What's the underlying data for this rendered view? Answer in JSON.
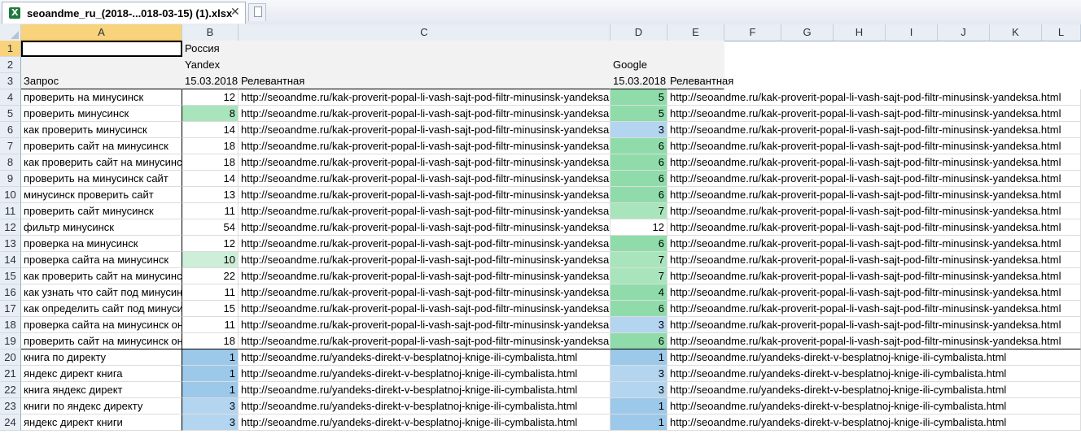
{
  "tab": {
    "title": "seoandme_ru_(2018-...018-03-15) (1).xlsx",
    "close": "✕"
  },
  "columns": [
    "A",
    "B",
    "C",
    "D",
    "E",
    "F",
    "G",
    "H",
    "I",
    "J",
    "K",
    "L"
  ],
  "header": {
    "region": "Россия",
    "yandex": "Yandex",
    "google": "Google",
    "query": "Запрос",
    "date": "15.03.2018",
    "relevant": "Релевантная"
  },
  "colors": {
    "green_dark": "#8fdcaa",
    "green_mid": "#a9e5bc",
    "green_light": "#cdeed8",
    "blue_dark": "#9cc8ea",
    "blue_mid": "#b3d5f0",
    "blue_light": "#c7e0f4"
  },
  "rows": [
    {
      "n": "4",
      "query": "проверить на минусинск",
      "y": "12",
      "yurl": "http://seoandme.ru/kak-proverit-popal-li-vash-sajt-pod-filtr-minusinsk-yandeksa.html",
      "g": "5",
      "gurl": "http://seoandme.ru/kak-proverit-popal-li-vash-sajt-pod-filtr-minusinsk-yandeksa.html",
      "yc": "",
      "gc": "green_dark"
    },
    {
      "n": "5",
      "query": "проверить минусинск",
      "y": "8",
      "yurl": "http://seoandme.ru/kak-proverit-popal-li-vash-sajt-pod-filtr-minusinsk-yandeksa.html",
      "g": "5",
      "gurl": "http://seoandme.ru/kak-proverit-popal-li-vash-sajt-pod-filtr-minusinsk-yandeksa.html",
      "yc": "green_mid",
      "gc": "green_dark"
    },
    {
      "n": "6",
      "query": "как проверить минусинск",
      "y": "14",
      "yurl": "http://seoandme.ru/kak-proverit-popal-li-vash-sajt-pod-filtr-minusinsk-yandeksa.html",
      "g": "3",
      "gurl": "http://seoandme.ru/kak-proverit-popal-li-vash-sajt-pod-filtr-minusinsk-yandeksa.html",
      "yc": "",
      "gc": "blue_mid"
    },
    {
      "n": "7",
      "query": "проверить сайт на минусинск",
      "y": "18",
      "yurl": "http://seoandme.ru/kak-proverit-popal-li-vash-sajt-pod-filtr-minusinsk-yandeksa.html",
      "g": "6",
      "gurl": "http://seoandme.ru/kak-proverit-popal-li-vash-sajt-pod-filtr-minusinsk-yandeksa.html",
      "yc": "",
      "gc": "green_dark"
    },
    {
      "n": "8",
      "query": "как проверить сайт на минусинск",
      "y": "18",
      "yurl": "http://seoandme.ru/kak-proverit-popal-li-vash-sajt-pod-filtr-minusinsk-yandeksa.html",
      "g": "6",
      "gurl": "http://seoandme.ru/kak-proverit-popal-li-vash-sajt-pod-filtr-minusinsk-yandeksa.html",
      "yc": "",
      "gc": "green_dark"
    },
    {
      "n": "9",
      "query": "проверить на минусинск сайт",
      "y": "14",
      "yurl": "http://seoandme.ru/kak-proverit-popal-li-vash-sajt-pod-filtr-minusinsk-yandeksa.html",
      "g": "6",
      "gurl": "http://seoandme.ru/kak-proverit-popal-li-vash-sajt-pod-filtr-minusinsk-yandeksa.html",
      "yc": "",
      "gc": "green_dark"
    },
    {
      "n": "10",
      "query": "минусинск проверить сайт",
      "y": "13",
      "yurl": "http://seoandme.ru/kak-proverit-popal-li-vash-sajt-pod-filtr-minusinsk-yandeksa.html",
      "g": "6",
      "gurl": "http://seoandme.ru/kak-proverit-popal-li-vash-sajt-pod-filtr-minusinsk-yandeksa.html",
      "yc": "",
      "gc": "green_dark"
    },
    {
      "n": "11",
      "query": "проверить сайт минусинск",
      "y": "11",
      "yurl": "http://seoandme.ru/kak-proverit-popal-li-vash-sajt-pod-filtr-minusinsk-yandeksa.html",
      "g": "7",
      "gurl": "http://seoandme.ru/kak-proverit-popal-li-vash-sajt-pod-filtr-minusinsk-yandeksa.html",
      "yc": "",
      "gc": "green_mid"
    },
    {
      "n": "12",
      "query": "фильтр минусинск",
      "y": "54",
      "yurl": "http://seoandme.ru/kak-proverit-popal-li-vash-sajt-pod-filtr-minusinsk-yandeksa.html",
      "g": "12",
      "gurl": "http://seoandme.ru/kak-proverit-popal-li-vash-sajt-pod-filtr-minusinsk-yandeksa.html",
      "yc": "",
      "gc": ""
    },
    {
      "n": "13",
      "query": "проверка на минусинск",
      "y": "12",
      "yurl": "http://seoandme.ru/kak-proverit-popal-li-vash-sajt-pod-filtr-minusinsk-yandeksa.html",
      "g": "6",
      "gurl": "http://seoandme.ru/kak-proverit-popal-li-vash-sajt-pod-filtr-minusinsk-yandeksa.html",
      "yc": "",
      "gc": "green_dark"
    },
    {
      "n": "14",
      "query": "проверка сайта на минусинск",
      "y": "10",
      "yurl": "http://seoandme.ru/kak-proverit-popal-li-vash-sajt-pod-filtr-minusinsk-yandeksa.html",
      "g": "7",
      "gurl": "http://seoandme.ru/kak-proverit-popal-li-vash-sajt-pod-filtr-minusinsk-yandeksa.html",
      "yc": "green_light",
      "gc": "green_mid"
    },
    {
      "n": "15",
      "query": "как проверить сайт на минусинск",
      "y": "22",
      "yurl": "http://seoandme.ru/kak-proverit-popal-li-vash-sajt-pod-filtr-minusinsk-yandeksa.html",
      "g": "7",
      "gurl": "http://seoandme.ru/kak-proverit-popal-li-vash-sajt-pod-filtr-minusinsk-yandeksa.html",
      "yc": "",
      "gc": "green_mid"
    },
    {
      "n": "16",
      "query": "как узнать что сайт под минусинском",
      "y": "11",
      "yurl": "http://seoandme.ru/kak-proverit-popal-li-vash-sajt-pod-filtr-minusinsk-yandeksa.html",
      "g": "4",
      "gurl": "http://seoandme.ru/kak-proverit-popal-li-vash-sajt-pod-filtr-minusinsk-yandeksa.html",
      "yc": "",
      "gc": "green_dark"
    },
    {
      "n": "17",
      "query": "как определить сайт под минусинском",
      "y": "15",
      "yurl": "http://seoandme.ru/kak-proverit-popal-li-vash-sajt-pod-filtr-minusinsk-yandeksa.html",
      "g": "6",
      "gurl": "http://seoandme.ru/kak-proverit-popal-li-vash-sajt-pod-filtr-minusinsk-yandeksa.html",
      "yc": "",
      "gc": "green_dark"
    },
    {
      "n": "18",
      "query": "проверка сайта на минусинск онлайн",
      "y": "11",
      "yurl": "http://seoandme.ru/kak-proverit-popal-li-vash-sajt-pod-filtr-minusinsk-yandeksa.html",
      "g": "3",
      "gurl": "http://seoandme.ru/kak-proverit-popal-li-vash-sajt-pod-filtr-minusinsk-yandeksa.html",
      "yc": "",
      "gc": "blue_mid"
    },
    {
      "n": "19",
      "query": "проверить сайт на минусинск онлайн",
      "y": "18",
      "yurl": "http://seoandme.ru/kak-proverit-popal-li-vash-sajt-pod-filtr-minusinsk-yandeksa.html",
      "g": "6",
      "gurl": "http://seoandme.ru/kak-proverit-popal-li-vash-sajt-pod-filtr-minusinsk-yandeksa.html",
      "yc": "",
      "gc": "green_dark"
    },
    {
      "n": "20",
      "query": "книга по директу",
      "y": "1",
      "yurl": "http://seoandme.ru/yandeks-direkt-v-besplatnoj-knige-ili-cymbalista.html",
      "g": "1",
      "gurl": "http://seoandme.ru/yandeks-direkt-v-besplatnoj-knige-ili-cymbalista.html",
      "yc": "blue_dark",
      "gc": "blue_dark"
    },
    {
      "n": "21",
      "query": "яндекс директ книга",
      "y": "1",
      "yurl": "http://seoandme.ru/yandeks-direkt-v-besplatnoj-knige-ili-cymbalista.html",
      "g": "3",
      "gurl": "http://seoandme.ru/yandeks-direkt-v-besplatnoj-knige-ili-cymbalista.html",
      "yc": "blue_dark",
      "gc": "blue_mid"
    },
    {
      "n": "22",
      "query": "книга яндекс директ",
      "y": "1",
      "yurl": "http://seoandme.ru/yandeks-direkt-v-besplatnoj-knige-ili-cymbalista.html",
      "g": "3",
      "gurl": "http://seoandme.ru/yandeks-direkt-v-besplatnoj-knige-ili-cymbalista.html",
      "yc": "blue_dark",
      "gc": "blue_mid"
    },
    {
      "n": "23",
      "query": "книги по яндекс директу",
      "y": "3",
      "yurl": "http://seoandme.ru/yandeks-direkt-v-besplatnoj-knige-ili-cymbalista.html",
      "g": "1",
      "gurl": "http://seoandme.ru/yandeks-direkt-v-besplatnoj-knige-ili-cymbalista.html",
      "yc": "blue_mid",
      "gc": "blue_dark"
    },
    {
      "n": "24",
      "query": "яндекс директ книги",
      "y": "3",
      "yurl": "http://seoandme.ru/yandeks-direkt-v-besplatnoj-knige-ili-cymbalista.html",
      "g": "1",
      "gurl": "http://seoandme.ru/yandeks-direkt-v-besplatnoj-knige-ili-cymbalista.html",
      "yc": "blue_mid",
      "gc": "blue_dark"
    }
  ]
}
